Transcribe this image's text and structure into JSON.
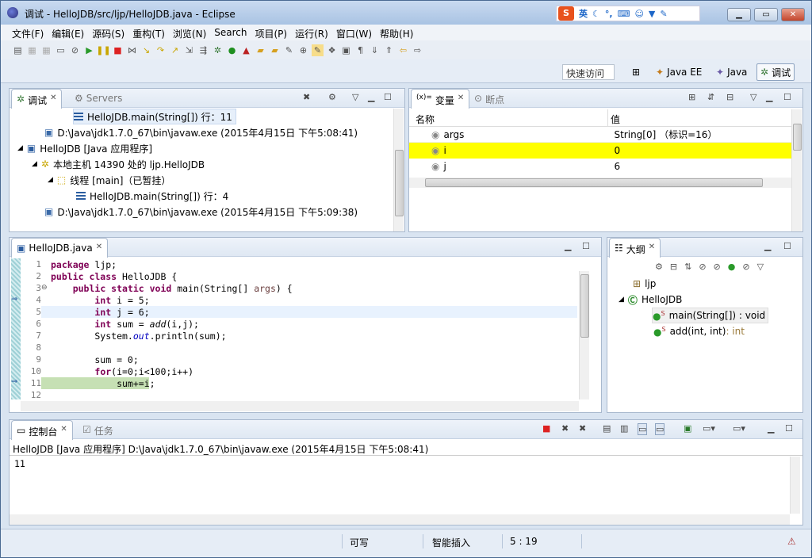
{
  "window": {
    "title": "调试 - HelloJDB/src/ljp/HelloJDB.java - Eclipse"
  },
  "ime": {
    "logo": "S",
    "lang": "英",
    "icons": [
      "moon-icon",
      "comma-icon",
      "keyboard-icon",
      "person-icon",
      "shirt-icon",
      "wrench-icon"
    ]
  },
  "menu": [
    "文件(F)",
    "编辑(E)",
    "源码(S)",
    "重构(T)",
    "浏览(N)",
    "Search",
    "项目(P)",
    "运行(R)",
    "窗口(W)",
    "帮助(H)"
  ],
  "perspective": {
    "quick_access": "快速访问",
    "javaee": "Java EE",
    "java": "Java",
    "debug": "调试"
  },
  "debug_view": {
    "tab": "调试",
    "tab_close": "✕",
    "servers_tab": "Servers",
    "rows": [
      "HelloJDB.main(String[]) 行：11",
      "D:\\Java\\jdk1.7.0_67\\bin\\javaw.exe (2015年4月15日 下午5:08:41)",
      "HelloJDB [Java 应用程序]",
      "本地主机 14390 处的 ljp.HelloJDB",
      "线程 [main]（已暂挂）",
      "HelloJDB.main(String[]) 行：4",
      "D:\\Java\\jdk1.7.0_67\\bin\\javaw.exe (2015年4月15日 下午5:09:38)"
    ]
  },
  "variables": {
    "tab": "变量",
    "breakpoints_tab": "断点",
    "col_name": "名称",
    "col_value": "值",
    "rows": [
      {
        "name": "args",
        "value": "String[0] （标识=16）"
      },
      {
        "name": "i",
        "value": "0",
        "highlight": true
      },
      {
        "name": "j",
        "value": "6"
      }
    ]
  },
  "editor": {
    "tab": "HelloJDB.java",
    "lines": [
      {
        "n": "1",
        "t": "package ljp;"
      },
      {
        "n": "2",
        "t": "public class HelloJDB {"
      },
      {
        "n": "3",
        "t": "    public static void main(String[] args) {"
      },
      {
        "n": "4",
        "t": "        int i = 5;"
      },
      {
        "n": "5",
        "t": "        int j = 6;"
      },
      {
        "n": "6",
        "t": "        int sum = add(i,j);"
      },
      {
        "n": "7",
        "t": "        System.out.println(sum);"
      },
      {
        "n": "8",
        "t": ""
      },
      {
        "n": "9",
        "t": "        sum = 0;"
      },
      {
        "n": "10",
        "t": "        for(i=0;i<100;i++)"
      },
      {
        "n": "11",
        "t": "            sum+=i;"
      },
      {
        "n": "12",
        "t": ""
      }
    ]
  },
  "outline": {
    "tab": "大纲",
    "items": [
      "ljp",
      "HelloJDB",
      "main(String[]) : void",
      "add(int, int)"
    ],
    "add_return": " : int"
  },
  "console": {
    "tab": "控制台",
    "tasks_tab": "任务",
    "header": "HelloJDB [Java 应用程序] D:\\Java\\jdk1.7.0_67\\bin\\javaw.exe (2015年4月15日 下午5:08:41)",
    "output": "11"
  },
  "status": {
    "writable": "可写",
    "insert": "智能插入",
    "position": "5 : 19"
  }
}
